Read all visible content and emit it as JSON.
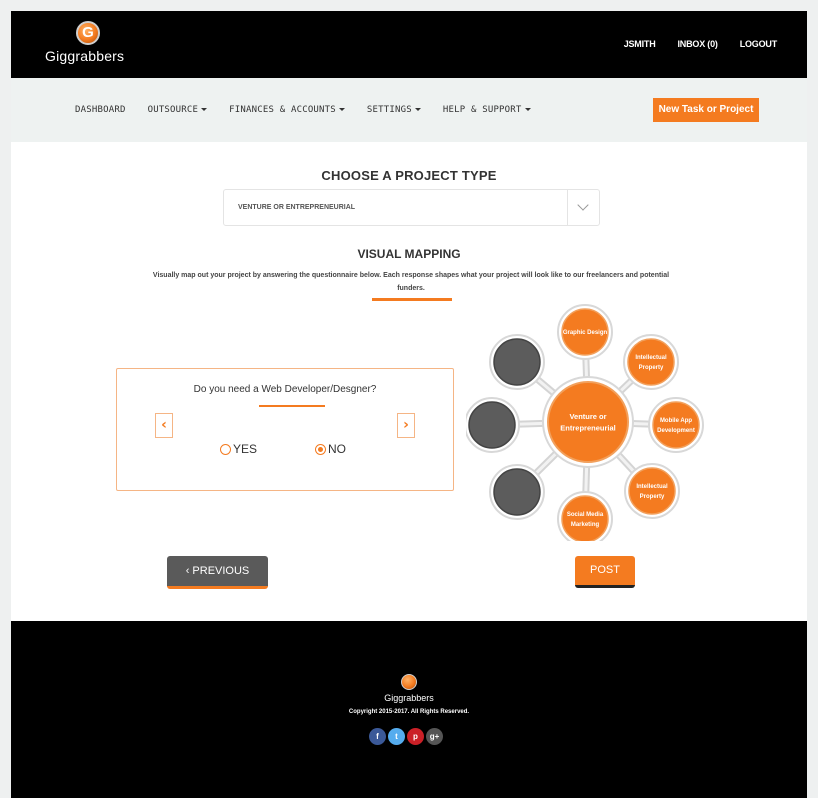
{
  "header": {
    "logo_text": "Giggrabbers",
    "user_nav": [
      "JSMITH",
      "INBOX (0)",
      "LOGOUT"
    ]
  },
  "nav": {
    "items": [
      {
        "label": "DASHBOARD",
        "dropdown": false
      },
      {
        "label": "OUTSOURCE",
        "dropdown": true
      },
      {
        "label": "FINANCES & ACCOUNTS",
        "dropdown": true
      },
      {
        "label": "SETTINGS",
        "dropdown": true
      },
      {
        "label": "HELP & SUPPORT",
        "dropdown": true
      }
    ],
    "cta_label": "New Task or Project"
  },
  "project": {
    "heading": "CHOOSE A PROJECT TYPE",
    "selected": "VENTURE OR ENTREPRENEURIAL"
  },
  "mapping": {
    "heading": "VISUAL MAPPING",
    "description": "Visually map out your project by answering the questionnaire below. Each response shapes what your project will look like to our freelancers and potential funders."
  },
  "question": {
    "text": "Do you need a Web Developer/Desgner?",
    "prev_arrow": "‹",
    "next_arrow": "›",
    "options": [
      "YES",
      "NO"
    ],
    "selected": "NO"
  },
  "diagram": {
    "center": [
      "Venture or",
      "Entrepreneurial"
    ],
    "nodes": [
      {
        "lines": [
          "Graphic Design"
        ],
        "active": true
      },
      {
        "lines": [
          "Intellectual",
          "Property"
        ],
        "active": true
      },
      {
        "lines": [
          "Mobile App",
          "Development"
        ],
        "active": true
      },
      {
        "lines": [
          "Intellectual",
          "Property"
        ],
        "active": true
      },
      {
        "lines": [
          "Social Media",
          "Marketing"
        ],
        "active": true
      },
      {
        "lines": [],
        "active": false
      },
      {
        "lines": [],
        "active": false
      },
      {
        "lines": [],
        "active": false
      }
    ],
    "colors": {
      "active": "#f47b20",
      "inactive": "#5c5c5c",
      "ring": "#f2a05c"
    }
  },
  "buttons": {
    "previous": "‹  PREVIOUS",
    "post": "POST"
  },
  "footer": {
    "logo_text": "Giggrabbers",
    "copyright": "Copyright 2015-2017. All Rights Reserved.",
    "socials": [
      {
        "name": "facebook-icon",
        "glyph": "f",
        "color": "#3b5998"
      },
      {
        "name": "twitter-icon",
        "glyph": "t",
        "color": "#55acee"
      },
      {
        "name": "pinterest-icon",
        "glyph": "p",
        "color": "#cb2027"
      },
      {
        "name": "google-plus-icon",
        "glyph": "g+",
        "color": "#555555"
      }
    ]
  },
  "colors": {
    "accent": "#f47b20"
  }
}
